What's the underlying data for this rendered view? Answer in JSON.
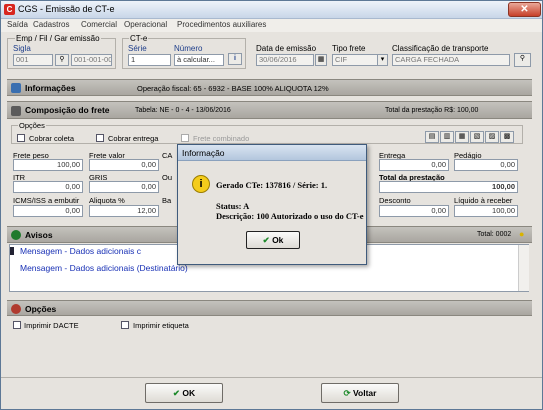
{
  "window": {
    "title": "CGS - Emissão de CT-e",
    "close": "✕"
  },
  "menu": [
    "Saída",
    "Cadastros",
    "Comercial",
    "Operacional",
    "Procedimentos auxiliares"
  ],
  "header": {
    "emp_label": "Emp / Fil / Gar emissão",
    "sigla_label": "Sigla",
    "sigla_value": "001",
    "emp_value": "001-001-001",
    "cte_label": "CT-e",
    "serie_label": "Série",
    "serie_value": "1",
    "numero_label": "Número",
    "numero_value": "à calcular...",
    "data_label": "Data de emissão",
    "data_value": "30/06/2016",
    "frete_label": "Tipo frete",
    "frete_value": "CIF",
    "class_label": "Classificação de transporte",
    "class_value": "CARGA FECHADA"
  },
  "info": {
    "title": "Informações",
    "text": "Operação fiscal: 65 - 6932 - BASE 100% ALIQUOTA 12%"
  },
  "composicao": {
    "title": "Composição do frete",
    "tabela": "Tabela: NE - 0 - 4 - 13/06/2016",
    "total_label": "Total da prestação R$: 100,00",
    "opcoes_label": "Opções",
    "cobrar_coleta": "Cobrar coleta",
    "cobrar_entrega": "Cobrar entrega",
    "frete_combinado": "Frete combinado"
  },
  "fields": {
    "frete_peso": {
      "label": "Frete peso",
      "value": "100,00"
    },
    "frete_valor": {
      "label": "Frete valor",
      "value": "0,00"
    },
    "ca": {
      "label": "CA",
      "value": ""
    },
    "itr": {
      "label": "ITR",
      "value": "0,00"
    },
    "gris": {
      "label": "GRIS",
      "value": "0,00"
    },
    "ou": {
      "label": "Ou",
      "value": ""
    },
    "icms": {
      "label": "ICMS/ISS a embutir",
      "value": "0,00"
    },
    "aliquota": {
      "label": "Aliquota %",
      "value": "12,00"
    },
    "ba": {
      "label": "Ba",
      "value": ""
    },
    "entrega": {
      "label": "Entrega",
      "value": "0,00"
    },
    "pedagio": {
      "label": "Pedágio",
      "value": "0,00"
    },
    "total_prest": {
      "label": "Total da prestação",
      "value": "100,00"
    },
    "desconto": {
      "label": "Desconto",
      "value": "0,00"
    },
    "liquido": {
      "label": "Líquido à receber",
      "value": "100,00"
    }
  },
  "avisos": {
    "title": "Avisos",
    "total": "Total: 0002",
    "rows": [
      "Mensagem - Dados adicionais c",
      "Mensagem - Dados adicionais (Destinatário)"
    ]
  },
  "opcoes": {
    "title": "Opções",
    "imprimir_dacte": "Imprimir DACTE",
    "imprimir_etiqueta": "Imprimir etiqueta"
  },
  "buttons": {
    "ok": "OK",
    "voltar": "Voltar"
  },
  "dialog": {
    "title": "Informação",
    "line1": "Gerado CTe: 137816 / Série: 1.",
    "line2": "Status: A",
    "line3": "Descrição: 100 Autorizado o uso do CT-e",
    "ok": "Ok"
  }
}
